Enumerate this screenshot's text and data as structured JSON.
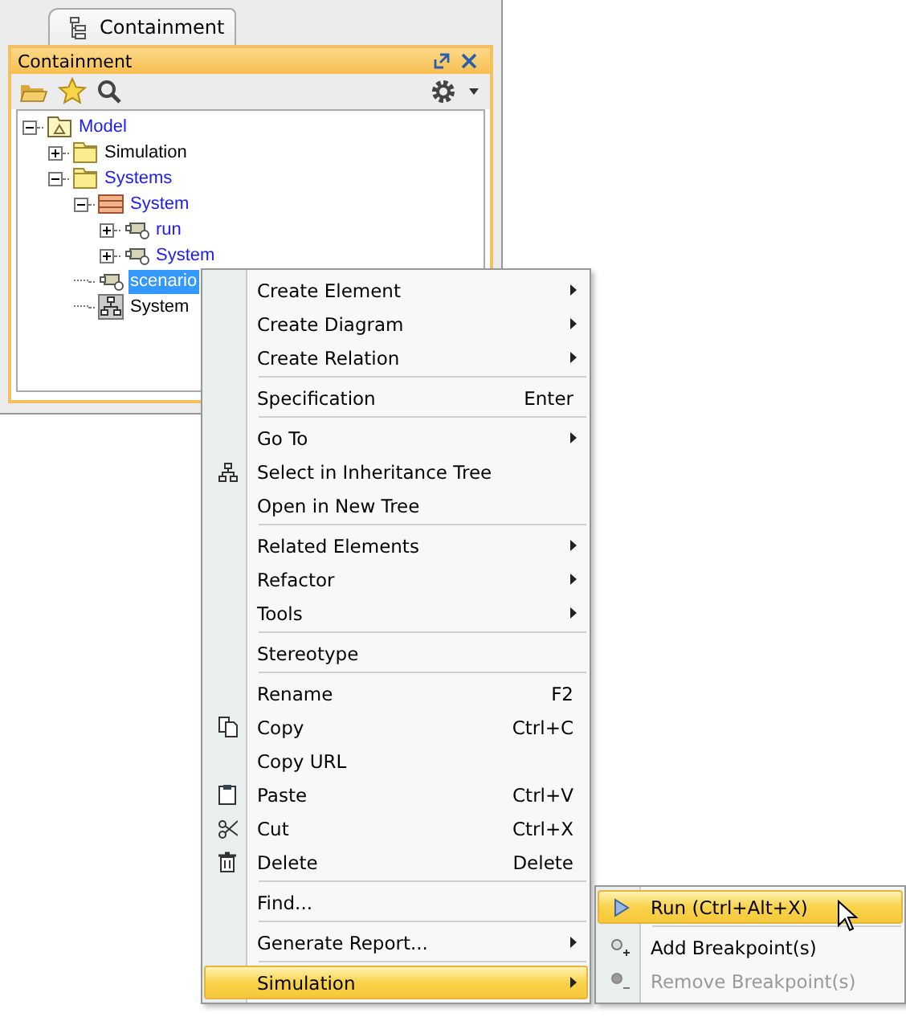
{
  "panel": {
    "tab": "Containment",
    "title": "Containment"
  },
  "tree": [
    {
      "label": "Model",
      "kind": "model",
      "blue": true,
      "expanded": true,
      "selected": false,
      "children": [
        {
          "label": "Simulation",
          "kind": "package",
          "blue": false,
          "expanded": false,
          "selected": false
        },
        {
          "label": "Systems",
          "kind": "package",
          "blue": true,
          "expanded": true,
          "selected": false,
          "children": [
            {
              "label": "System",
              "kind": "block",
              "blue": true,
              "expanded": true,
              "selected": false,
              "children": [
                {
                  "label": "run",
                  "kind": "part",
                  "blue": true,
                  "expanded": false,
                  "selected": false
                },
                {
                  "label": "System",
                  "kind": "part",
                  "blue": true,
                  "expanded": false,
                  "selected": false
                }
              ]
            },
            {
              "label": "scenario",
              "kind": "part",
              "blue": false,
              "selected": true
            },
            {
              "label": "System",
              "kind": "diagram",
              "blue": false,
              "selected": false
            }
          ]
        }
      ]
    }
  ],
  "context_menu": [
    [
      {
        "label": "Create Element",
        "submenu": true,
        "selected": false
      },
      {
        "label": "Create Diagram",
        "submenu": true,
        "selected": false
      },
      {
        "label": "Create Relation",
        "submenu": true,
        "selected": false
      }
    ],
    [
      {
        "label": "Specification",
        "shortcut": "Enter",
        "selected": false
      }
    ],
    [
      {
        "label": "Go To",
        "submenu": true,
        "selected": false
      },
      {
        "label": "Select in Inheritance Tree",
        "kind": "hierarchy",
        "selected": false
      },
      {
        "label": "Open in New Tree",
        "selected": false
      }
    ],
    [
      {
        "label": "Related Elements",
        "submenu": true,
        "selected": false
      },
      {
        "label": "Refactor",
        "submenu": true,
        "selected": false
      },
      {
        "label": "Tools",
        "submenu": true,
        "selected": false
      }
    ],
    [
      {
        "label": "Stereotype",
        "selected": false
      }
    ],
    [
      {
        "label": "Rename",
        "shortcut": "F2",
        "selected": false
      },
      {
        "label": "Copy",
        "shortcut": "Ctrl+C",
        "kind": "copy",
        "selected": false
      },
      {
        "label": "Copy URL",
        "selected": false
      },
      {
        "label": "Paste",
        "shortcut": "Ctrl+V",
        "kind": "paste",
        "selected": false
      },
      {
        "label": "Cut",
        "shortcut": "Ctrl+X",
        "kind": "cut",
        "selected": false
      },
      {
        "label": "Delete",
        "shortcut": "Delete",
        "kind": "delete",
        "selected": false
      }
    ],
    [
      {
        "label": "Find...",
        "selected": false
      }
    ],
    [
      {
        "label": "Generate Report...",
        "submenu": true,
        "selected": false
      }
    ],
    [
      {
        "label": "Simulation",
        "submenu": true,
        "selected": true
      }
    ]
  ],
  "submenu": [
    [
      {
        "label": "Run (Ctrl+Alt+X)",
        "kind": "run",
        "selected": true,
        "disabled": false
      }
    ],
    [
      {
        "label": "Add Breakpoint(s)",
        "kind": "add-breakpoint",
        "selected": false,
        "disabled": false
      },
      {
        "label": "Remove Breakpoint(s)",
        "kind": "remove-breakpoint",
        "selected": false,
        "disabled": true
      }
    ]
  ]
}
